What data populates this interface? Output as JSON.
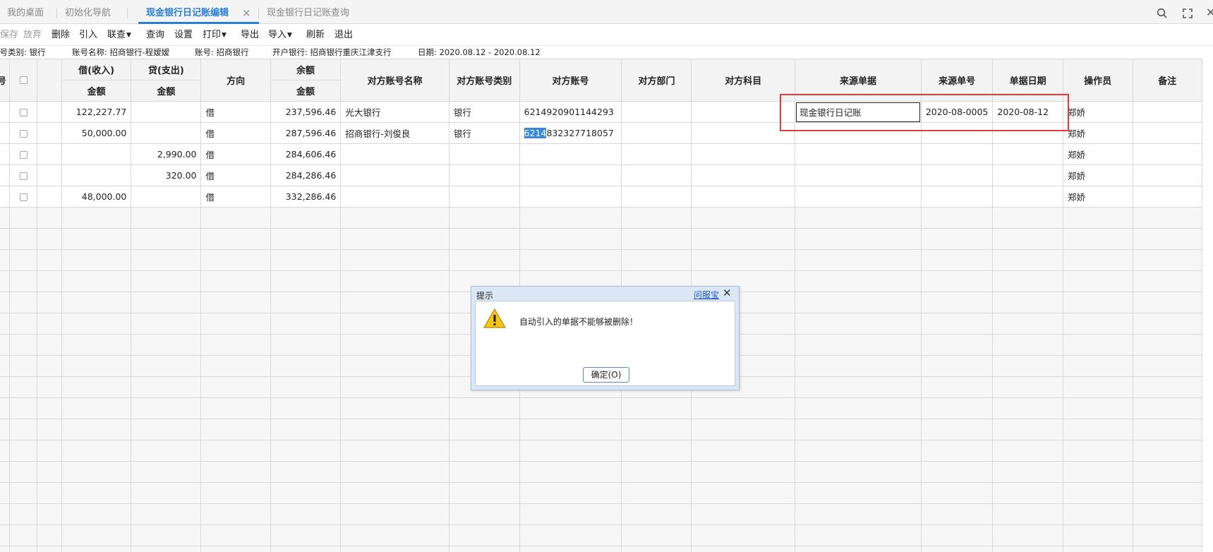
{
  "tabs": [
    {
      "label": "我的桌面"
    },
    {
      "label": "初始化导航"
    },
    {
      "label": "现金银行日记账编辑"
    },
    {
      "label": "现金银行日记账查询"
    }
  ],
  "toolbar": {
    "save": "保存",
    "discard": "放弃",
    "delete": "删除",
    "import_ref": "引入",
    "linked_query": "联查",
    "query": "查询",
    "settings": "设置",
    "print": "打印",
    "export": "导出",
    "import": "导入",
    "refresh": "刷新",
    "exit": "退出"
  },
  "info": {
    "account_type": "账号类别: 银行",
    "account_name": "账号名称: 招商银行-程嫒嫒",
    "account_no": "账号: 招商银行",
    "bank": "开户银行: 招商银行重庆江津支行",
    "date": "日期: 2020.08.12 - 2020.08.12"
  },
  "columns": {
    "seq": "号",
    "debit": "借(收入)",
    "credit": "贷(支出)",
    "amount": "金额",
    "direction": "方向",
    "balance": "余额",
    "counter_name": "对方账号名称",
    "counter_type": "对方账号类别",
    "counter_no": "对方账号",
    "counter_dept": "对方部门",
    "counter_subject": "对方科目",
    "source_doc": "来源单据",
    "source_no": "来源单号",
    "doc_date": "单据日期",
    "operator": "操作员",
    "remark": "备注"
  },
  "rows": [
    {
      "debit": "122,227.77",
      "credit": "",
      "direction": "借",
      "balance": "237,596.46",
      "counter_name": "光大银行",
      "counter_type": "银行",
      "counter_no_hl": "",
      "counter_no": "6214920901144293",
      "source_doc": "现金银行日记账",
      "source_no": "2020-08-0005",
      "doc_date": "2020-08-12",
      "operator": "郑娇"
    },
    {
      "debit": "50,000.00",
      "credit": "",
      "direction": "借",
      "balance": "287,596.46",
      "counter_name": "招商银行-刘俊良",
      "counter_type": "银行",
      "counter_no_hl": "6214",
      "counter_no": "832327718057",
      "source_doc": "",
      "source_no": "",
      "doc_date": "",
      "operator": "郑娇"
    },
    {
      "debit": "",
      "credit": "2,990.00",
      "direction": "借",
      "balance": "284,606.46",
      "counter_name": "",
      "counter_type": "",
      "counter_no_hl": "",
      "counter_no": "",
      "source_doc": "",
      "source_no": "",
      "doc_date": "",
      "operator": "郑娇"
    },
    {
      "debit": "",
      "credit": "320.00",
      "direction": "借",
      "balance": "284,286.46",
      "counter_name": "",
      "counter_type": "",
      "counter_no_hl": "",
      "counter_no": "",
      "source_doc": "",
      "source_no": "",
      "doc_date": "",
      "operator": "郑娇"
    },
    {
      "debit": "48,000.00",
      "credit": "",
      "direction": "借",
      "balance": "332,286.46",
      "counter_name": "",
      "counter_type": "",
      "counter_no_hl": "",
      "counter_no": "",
      "source_doc": "",
      "source_no": "",
      "doc_date": "",
      "operator": "郑娇"
    }
  ],
  "dialog": {
    "title": "提示",
    "help_link": "问服宝",
    "message": "自动引入的单据不能够被删除！",
    "ok_button": "确定(O)"
  },
  "colors": {
    "accent": "#2a7fd4",
    "highlight_box": "#e83a3a",
    "dialog_frame": "#dbe7f5"
  }
}
